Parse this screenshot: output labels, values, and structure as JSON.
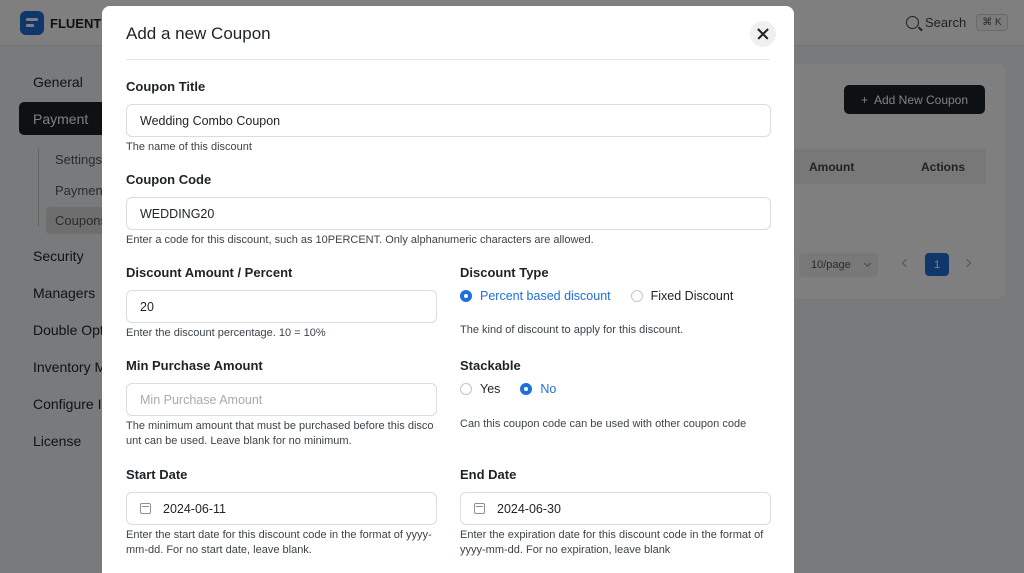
{
  "app": {
    "brand": "FLUENT FO",
    "search_label": "Search",
    "shortcut": "⌘ K"
  },
  "sidebar": {
    "items": [
      {
        "label": "General"
      },
      {
        "label": "Payment"
      },
      {
        "label": "Security"
      },
      {
        "label": "Managers"
      },
      {
        "label": "Double Opt-"
      },
      {
        "label": "Inventory M"
      },
      {
        "label": "Configure In"
      },
      {
        "label": "License"
      }
    ],
    "sub_items": [
      {
        "label": "Settings"
      },
      {
        "label": "Payment"
      },
      {
        "label": "Coupons"
      }
    ]
  },
  "coupons_page": {
    "add_button": "Add New Coupon",
    "columns": [
      "Amount",
      "Actions"
    ],
    "page_size": "10/page",
    "current_page": "1"
  },
  "modal": {
    "title": "Add a new Coupon",
    "coupon_title": {
      "label": "Coupon Title",
      "value": "Wedding Combo Coupon",
      "help": "The name of this discount"
    },
    "coupon_code": {
      "label": "Coupon Code",
      "value": "WEDDING20",
      "help": "Enter a code for this discount, such as 10PERCENT. Only alphanumeric characters are allowed."
    },
    "discount_amount": {
      "label": "Discount Amount / Percent",
      "value": "20",
      "help": "Enter the discount percentage. 10 = 10%"
    },
    "discount_type": {
      "label": "Discount Type",
      "options": [
        "Percent based discount",
        "Fixed Discount"
      ],
      "selected": "Percent based discount",
      "help": "The kind of discount to apply for this discount."
    },
    "min_purchase": {
      "label": "Min Purchase Amount",
      "placeholder": "Min Purchase Amount",
      "help_line1": "The minimum amount that must be purchased before this disco",
      "help_line2": "unt can be used. Leave blank for no minimum."
    },
    "stackable": {
      "label": "Stackable",
      "options": [
        "Yes",
        "No"
      ],
      "selected": "No",
      "help": "Can this coupon code can be used with other coupon code"
    },
    "start_date": {
      "label": "Start Date",
      "value": "2024-06-11",
      "help_line1": "Enter the start date for this discount code in the format of yyyy-",
      "help_line2": "mm-dd. For no start date, leave blank."
    },
    "end_date": {
      "label": "End Date",
      "value": "2024-06-30",
      "help_line1": "Enter the expiration date for this discount code in the format of",
      "help_line2": "yyyy-mm-dd. For no expiration, leave blank"
    }
  },
  "colors": {
    "accent": "#1e6fd9",
    "dark": "#1d2327",
    "overlay": "rgba(0,0,0,0.5)"
  }
}
